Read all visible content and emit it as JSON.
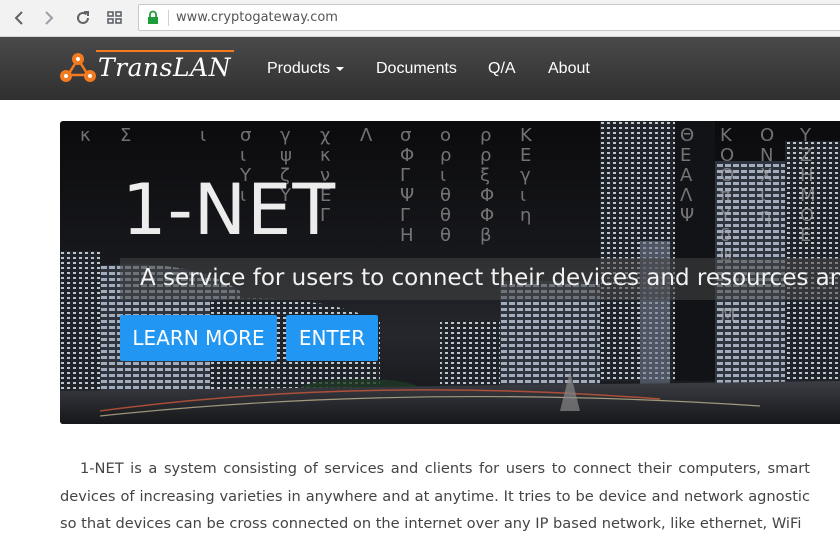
{
  "browser": {
    "url": "www.cryptogateway.com",
    "icons": [
      "back-icon",
      "forward-icon",
      "reload-icon",
      "apps-icon",
      "lock-icon"
    ]
  },
  "nav": {
    "logo_text": "TransLAN",
    "items": [
      {
        "label": "Products"
      },
      {
        "label": "Documents"
      },
      {
        "label": "Q/A"
      },
      {
        "label": "About"
      }
    ]
  },
  "hero": {
    "title": "1-NET",
    "tagline": "A service for users to connect their devices and resources anywhere",
    "buttons": [
      {
        "label": "LEARN MORE"
      },
      {
        "label": "ENTER"
      }
    ],
    "glyphs": "κΣισγχΛσορΚΘΚΟΥ"
  },
  "content": {
    "paragraph": "1-NET is a system consisting of services and clients for users to connect their computers, smart devices of increasing varieties in anywhere and at anytime. It tries to be device and network agnostic so that devices can be cross connected on the internet over any IP based network, like ethernet, WiFi"
  },
  "colors": {
    "accent": "#2196f3",
    "logo_orange": "#f47a1f",
    "nav_bg": "#3a3a3a",
    "secure": "#1e9e3a"
  }
}
